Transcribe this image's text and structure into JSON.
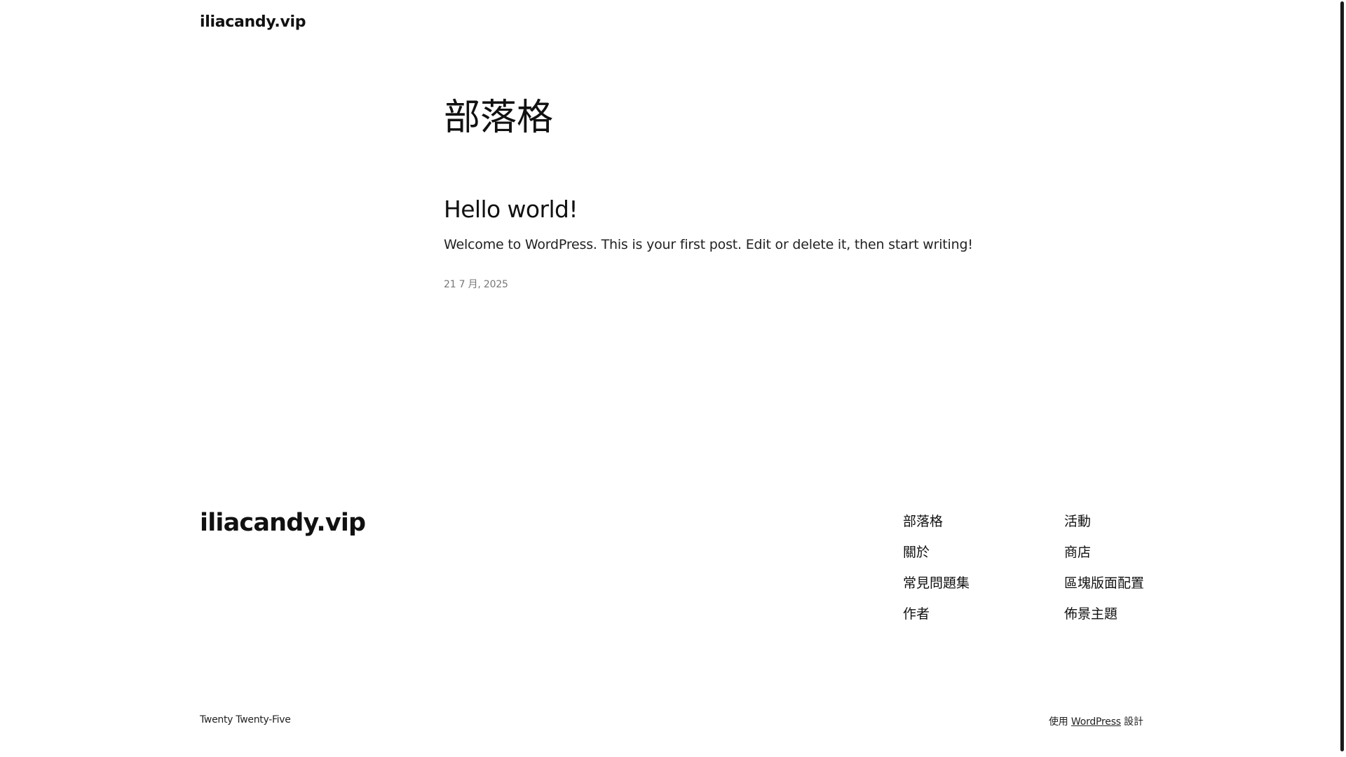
{
  "header": {
    "site_title": "iliacandy.vip"
  },
  "main": {
    "page_title": "部落格",
    "post": {
      "title": "Hello world!",
      "excerpt": "Welcome to WordPress. This is your first post. Edit or delete it, then start writing!",
      "date": "21 7 月, 2025"
    }
  },
  "footer": {
    "site_title": "iliacandy.vip",
    "nav_col1": [
      "部落格",
      "關於",
      "常見問題集",
      "作者"
    ],
    "nav_col2": [
      "活動",
      "商店",
      "區塊版面配置",
      "佈景主題"
    ],
    "theme_credit": "Twenty Twenty-Five",
    "powered_prefix": "使用",
    "powered_link": "WordPress",
    "powered_suffix": "設計"
  }
}
